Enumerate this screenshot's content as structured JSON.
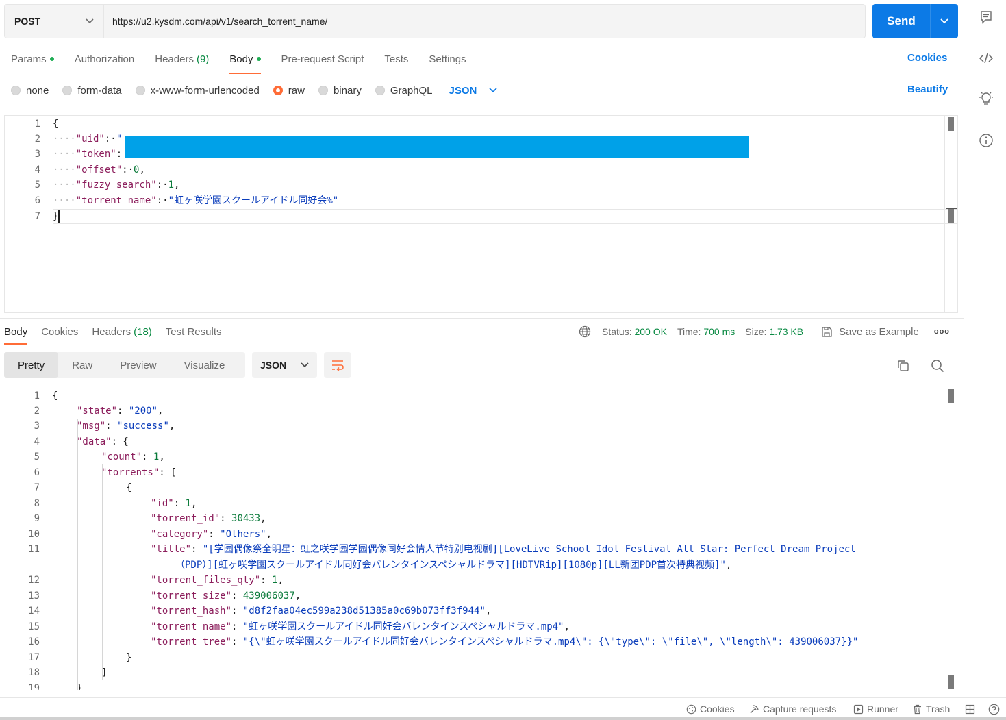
{
  "request": {
    "method": "POST",
    "url": "https://u2.kysdm.com/api/v1/search_torrent_name/",
    "send_label": "Send"
  },
  "request_tabs": {
    "params": "Params",
    "authorization": "Authorization",
    "headers": "Headers",
    "headers_count": "(9)",
    "body": "Body",
    "pre_request": "Pre-request Script",
    "tests": "Tests",
    "settings": "Settings",
    "cookies_link": "Cookies"
  },
  "body_types": {
    "none": "none",
    "form_data": "form-data",
    "urlencoded": "x-www-form-urlencoded",
    "raw": "raw",
    "binary": "binary",
    "graphql": "GraphQL",
    "language": "JSON",
    "beautify": "Beautify",
    "selected": "raw"
  },
  "request_body": {
    "line_numbers": [
      "1",
      "2",
      "3",
      "4",
      "5",
      "6",
      "7"
    ],
    "open_brace": "{",
    "close_brace": "}",
    "uid_key": "\"uid\"",
    "uid_val": "\"",
    "token_key": "\"token\"",
    "offset_key": "\"offset\"",
    "offset_val": "0",
    "fuzzy_key": "\"fuzzy_search\"",
    "fuzzy_val": "1",
    "name_key": "\"torrent_name\"",
    "name_val": "\"虹ヶ咲学園スクールアイドル同好会%\""
  },
  "response_tabs": {
    "body": "Body",
    "cookies": "Cookies",
    "headers": "Headers",
    "headers_count": "(18)",
    "test_results": "Test Results"
  },
  "response_stats": {
    "status_label": "Status:",
    "status_value": "200 OK",
    "time_label": "Time:",
    "time_value": "700 ms",
    "size_label": "Size:",
    "size_value": "1.73 KB",
    "save_example": "Save as Example",
    "more": "ooo"
  },
  "view_tabs": {
    "pretty": "Pretty",
    "raw": "Raw",
    "preview": "Preview",
    "visualize": "Visualize",
    "format": "JSON"
  },
  "response_body": {
    "line_numbers": [
      "1",
      "2",
      "3",
      "4",
      "5",
      "6",
      "7",
      "8",
      "9",
      "10",
      "11",
      "",
      "12",
      "13",
      "14",
      "15",
      "16",
      "17",
      "18",
      "19"
    ],
    "open_brace": "{",
    "state_key": "\"state\"",
    "state_val": "\"200\"",
    "msg_key": "\"msg\"",
    "msg_val": "\"success\"",
    "data_key": "\"data\"",
    "count_key": "\"count\"",
    "count_val": "1",
    "torrents_key": "\"torrents\"",
    "id_key": "\"id\"",
    "id_val": "1",
    "torrent_id_key": "\"torrent_id\"",
    "torrent_id_val": "30433",
    "category_key": "\"category\"",
    "category_val": "\"Others\"",
    "title_key": "\"title\"",
    "title_val_1": "\"[学园偶像祭全明星：虹之咲学园学园偶像同好会情人节特别电视剧][LoveLive School Idol Festival All Star: Perfect Dream Project",
    "title_val_2": "（PDP）][虹ヶ咲学園スクールアイドル同好会バレンタインスペシャルドラマ][HDTVRip][1080p][LL新团PDP首次特典视频]\"",
    "files_qty_key": "\"torrent_files_qty\"",
    "files_qty_val": "1",
    "size_key": "\"torrent_size\"",
    "size_val": "439006037",
    "hash_key": "\"torrent_hash\"",
    "hash_val": "\"d8f2faa04ec599a238d51385a0c69b073ff3f944\"",
    "tname_key": "\"torrent_name\"",
    "tname_val": "\"虹ヶ咲学園スクールアイドル同好会バレンタインスペシャルドラマ.mp4\"",
    "tree_key": "\"torrent_tree\"",
    "tree_val": "\"{\\\"虹ヶ咲学園スクールアイドル同好会バレンタインスペシャルドラマ.mp4\\\": {\\\"type\\\": \\\"file\\\", \\\"length\\\": 439006037}}\""
  },
  "footer": {
    "cookies": "Cookies",
    "capture": "Capture requests",
    "runner": "Runner",
    "trash": "Trash"
  },
  "colors": {
    "accent_blue": "#0c7ae6",
    "accent_orange": "#ff6c37",
    "status_green": "#0a8a43",
    "redaction": "#00a1e8"
  },
  "icons": [
    "chevron-down-icon",
    "comment-icon",
    "code-icon",
    "bulb-icon",
    "info-icon",
    "globe-icon",
    "save-icon",
    "copy-icon",
    "search-icon",
    "wrap-icon",
    "cookie-icon",
    "capture-icon",
    "runner-icon",
    "trash-icon",
    "layout-icon",
    "help-icon"
  ]
}
